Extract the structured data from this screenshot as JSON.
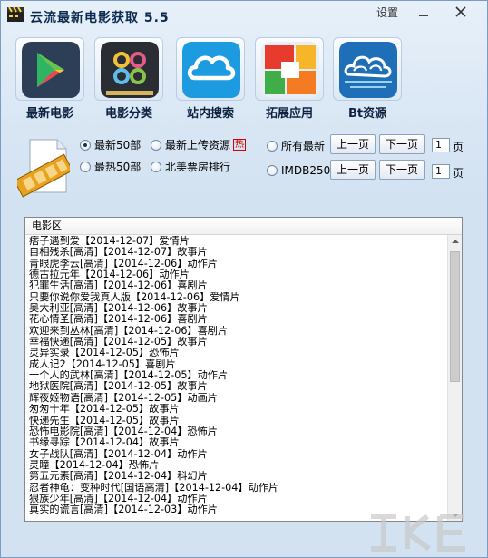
{
  "window": {
    "title": "云流最新电影获取 5.5",
    "settings_label": "设置"
  },
  "toolbar": {
    "items": [
      {
        "label": "最新电影",
        "icon": "play-store-icon"
      },
      {
        "label": "电影分类",
        "icon": "category-grid-icon"
      },
      {
        "label": "站内搜索",
        "icon": "cloud-icon"
      },
      {
        "label": "拓展应用",
        "icon": "apps-tiles-icon"
      },
      {
        "label": "Bt资源",
        "icon": "bt-cloud-icon"
      }
    ]
  },
  "filters": {
    "latest50": "最新50部",
    "hottest50": "最热50部",
    "latest_upload": "最新上传资源",
    "hot_badge": "热",
    "na_boxoffice": "北美票房排行",
    "all_latest": "所有最新",
    "imdb250": "IMDB250",
    "selected": "latest50",
    "prev_page": "上一页",
    "next_page": "下一页",
    "page1_value": "1",
    "page2_value": "1",
    "page_label": "页"
  },
  "list": {
    "header": "电影区",
    "rows": [
      "痞子遇到爱【2014-12-07】爱情片",
      "自相残杀[高清]【2014-12-07】故事片",
      "青眼虎李云[高清]【2014-12-06】动作片",
      "德古拉元年【2014-12-06】动作片",
      "犯罪生活[高清]【2014-12-06】喜剧片",
      "只要你说你爱我真人版【2014-12-06】爱情片",
      "奥大利亚[高清]【2014-12-06】故事片",
      "花心情圣[高清]【2014-12-06】喜剧片",
      "欢迎来到丛林[高清]【2014-12-06】喜剧片",
      "幸福快递[高清]【2014-12-05】故事片",
      "灵异实录【2014-12-05】恐怖片",
      "成人记2【2014-12-05】喜剧片",
      "一个人的武林[高清]【2014-12-05】动作片",
      "地狱医院[高清]【2014-12-05】故事片",
      "辉夜姬物语[高清]【2014-12-05】动画片",
      "匆匆十年【2014-12-05】故事片",
      "快递先生【2014-12-05】故事片",
      "恐怖电影院[高清]【2014-12-04】恐怖片",
      "书缘寻踪【2014-12-04】故事片",
      "女子战队[高清]【2014-12-04】动作片",
      "灵瞳【2014-12-04】恐怖片",
      "第五元素[高清]【2014-12-04】科幻片",
      "忍者神龟：变种时代[国语高清]【2014-12-04】动作片",
      "狼族少年[高清]【2014-12-04】动作片",
      "真实的谎言[高清]【2014-12-03】动作片"
    ]
  },
  "colors": {
    "window_bg": "#d8e6f4",
    "hot_badge": "#d10000"
  }
}
